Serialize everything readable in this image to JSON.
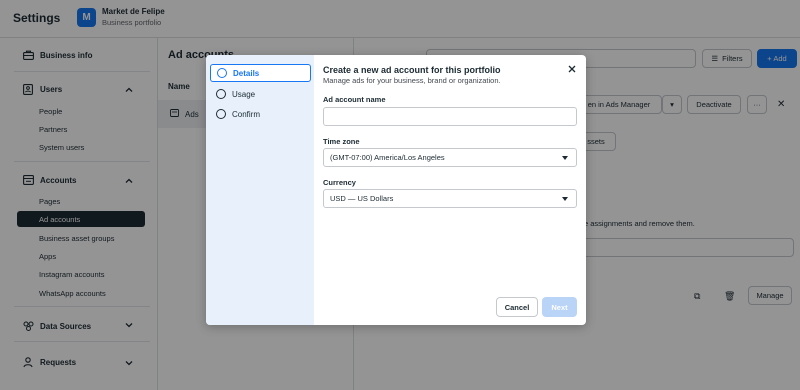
{
  "topbar": {
    "title": "Settings",
    "portfolio_initial": "M",
    "portfolio_name": "Market de Felipe",
    "portfolio_sub": "Business portfolio"
  },
  "sidebar": {
    "business_info": "Business info",
    "users": {
      "label": "Users",
      "items": [
        "People",
        "Partners",
        "System users"
      ]
    },
    "accounts": {
      "label": "Accounts",
      "items": [
        "Pages",
        "Ad accounts",
        "Business asset groups",
        "Apps",
        "Instagram accounts",
        "WhatsApp accounts"
      ],
      "active_index": 1
    },
    "data_sources": "Data Sources",
    "requests": "Requests"
  },
  "main": {
    "heading": "Ad accounts",
    "column_name": "Name",
    "row_label": "Ads",
    "filters": "Filters",
    "add": "+ Add",
    "open_in_ads_manager": "en in Ads Manager",
    "deactivate": "Deactivate",
    "assets_btn": "ssets",
    "assignments_text": "e assignments and remove them.",
    "manage": "Manage"
  },
  "modal": {
    "steps": [
      "Details",
      "Usage",
      "Confirm"
    ],
    "active_step": 0,
    "title": "Create a new ad account for this portfolio",
    "subtitle": "Manage ads for your business, brand or organization.",
    "name_label": "Ad account name",
    "name_value": "",
    "timezone_label": "Time zone",
    "timezone_value": "(GMT-07:00) America/Los Angeles",
    "currency_label": "Currency",
    "currency_value": "USD — US Dollars",
    "cancel": "Cancel",
    "next": "Next"
  },
  "colors": {
    "accent": "#1877f2",
    "sidebar_active": "#1c2b33",
    "steps_bg": "#e7f0fb"
  }
}
